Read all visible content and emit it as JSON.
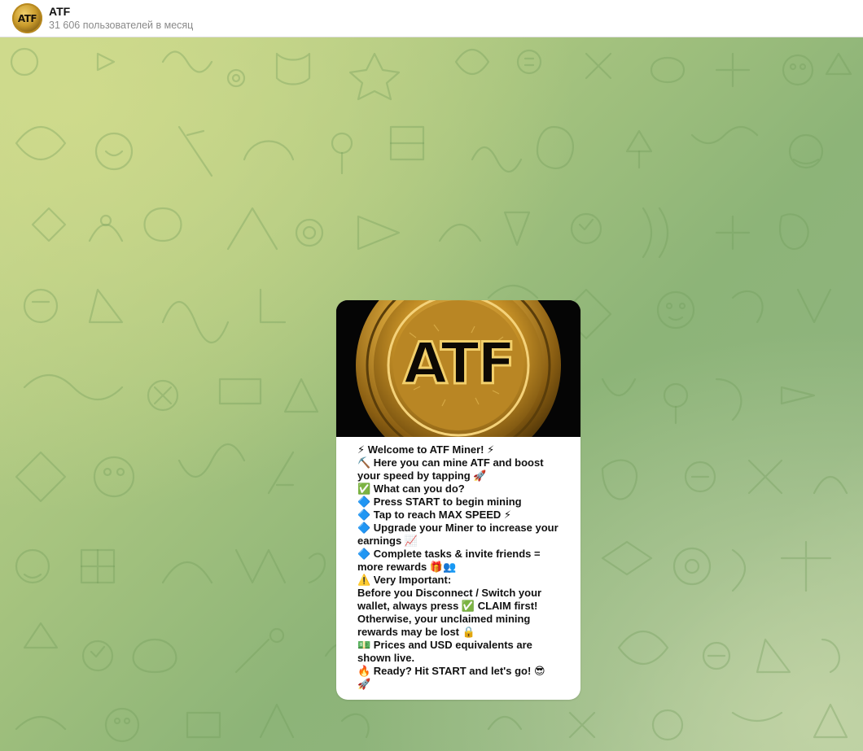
{
  "header": {
    "title": "ATF",
    "subtitle": "31 606 пользователей в месяц",
    "avatar_text": "ATF"
  },
  "message": {
    "image_text": "ATF",
    "lines": [
      "⚡ Welcome to ATF Miner! ⚡",
      "⛏️ Here you can mine ATF and boost",
      "your speed by tapping 🚀",
      "✅ What can you do?",
      "🔷 Press START to begin mining",
      "🔷 Tap to reach MAX SPEED ⚡",
      "🔷 Upgrade your Miner to increase your",
      "earnings 📈",
      "🔷 Complete tasks & invite friends =",
      "more rewards 🎁👥",
      "⚠️ Very Important:",
      "Before you Disconnect / Switch your",
      "wallet, always press ✅ CLAIM first!",
      "Otherwise, your unclaimed mining",
      "rewards may be lost 🔒",
      "💵 Prices and USD equivalents are",
      "shown live.",
      "🔥 Ready? Hit START and let's go! 😎",
      "🚀"
    ]
  },
  "colors": {
    "header_bg": "#ffffff",
    "bubble_bg": "#ffffff",
    "coin_gold": "#d4a437",
    "wallpaper_light": "#c4d58c",
    "wallpaper_dark": "#8db478"
  }
}
